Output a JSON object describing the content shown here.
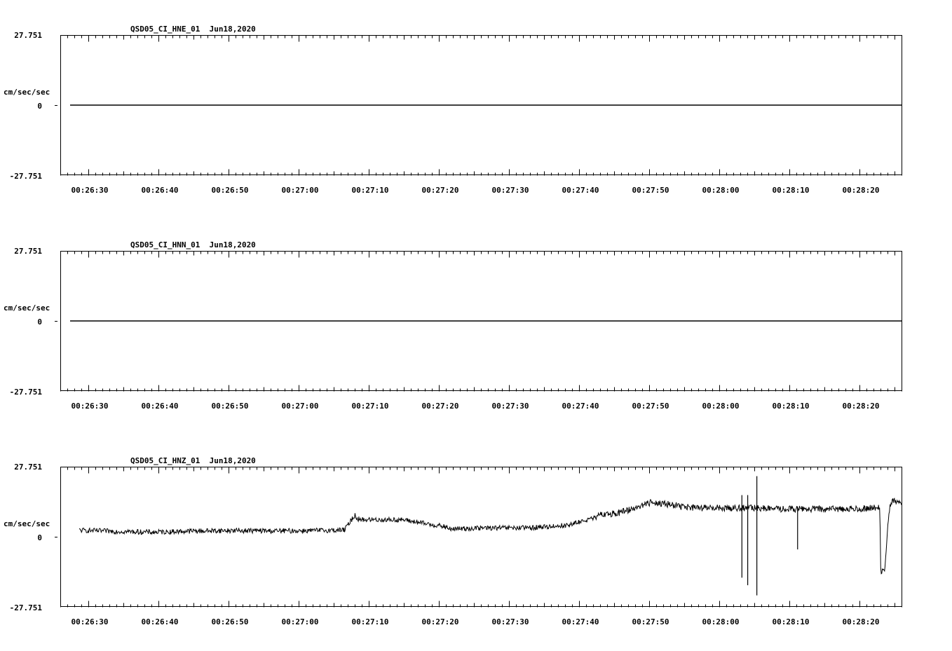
{
  "chart_data": [
    {
      "type": "line",
      "title": "QSD05_CI_HNE_01  Jun18,2020",
      "ylabel": "cm/sec/sec",
      "ylim": [
        -27.751,
        27.751
      ],
      "y_ticks": [
        "27.751",
        "0",
        "-27.751"
      ],
      "x_tick_labels": [
        "00:26:30",
        "00:26:40",
        "00:26:50",
        "00:27:00",
        "00:27:10",
        "00:27:20",
        "00:27:30",
        "00:27:40",
        "00:27:50",
        "00:28:00",
        "00:28:10",
        "00:28:20"
      ],
      "series": [
        {
          "x": [
            0,
            1
          ],
          "values": [
            0,
            0
          ]
        }
      ]
    },
    {
      "type": "line",
      "title": "QSD05_CI_HNN_01  Jun18,2020",
      "ylabel": "cm/sec/sec",
      "ylim": [
        -27.751,
        27.751
      ],
      "y_ticks": [
        "27.751",
        "0",
        "-27.751"
      ],
      "x_tick_labels": [
        "00:26:30",
        "00:26:40",
        "00:26:50",
        "00:27:00",
        "00:27:10",
        "00:27:20",
        "00:27:30",
        "00:27:40",
        "00:27:50",
        "00:28:00",
        "00:28:10",
        "00:28:20"
      ],
      "series": [
        {
          "x": [
            0,
            1
          ],
          "values": [
            0,
            0
          ]
        }
      ]
    },
    {
      "type": "line",
      "title": "QSD05_CI_HNZ_01  Jun18,2020",
      "ylabel": "cm/sec/sec",
      "ylim": [
        -27.751,
        27.751
      ],
      "y_ticks": [
        "27.751",
        "0",
        "-27.751"
      ],
      "x_tick_labels": [
        "00:26:30",
        "00:26:40",
        "00:26:50",
        "00:27:00",
        "00:27:10",
        "00:27:20",
        "00:27:30",
        "00:27:40",
        "00:27:50",
        "00:28:00",
        "00:28:10",
        "00:28:20"
      ],
      "series": [
        {
          "x": [
            0.011,
            0.05,
            0.1,
            0.15,
            0.2,
            0.25,
            0.3,
            0.33,
            0.343,
            0.345,
            0.35,
            0.4,
            0.45,
            0.455,
            0.46,
            0.5,
            0.55,
            0.6,
            0.62,
            0.63,
            0.635,
            0.64,
            0.66,
            0.7,
            0.75,
            0.8,
            0.83,
            0.85,
            0.86,
            0.87,
            0.9,
            0.95,
            0.974,
            0.975,
            0.98,
            0.985,
            0.99,
            1.0
          ],
          "values": [
            2.6,
            2.2,
            1.8,
            2.3,
            2.5,
            2.3,
            2.5,
            2.7,
            8.9,
            7.2,
            6.8,
            6.7,
            4.0,
            3.2,
            3.1,
            3.5,
            3.5,
            4.6,
            6.6,
            7.2,
            8.1,
            8.9,
            9.4,
            13.8,
            11.4,
            11.4,
            11.4,
            11.0,
            11.0,
            11.0,
            11.0,
            11.1,
            11.7,
            -14.4,
            -12.5,
            10.9,
            14.3,
            13.3
          ]
        }
      ],
      "spikes": [
        {
          "x": 0.808,
          "values": [
            16.5,
            -16.2
          ]
        },
        {
          "x": 0.815,
          "values": [
            16.5,
            -19.2
          ]
        },
        {
          "x": 0.826,
          "values": [
            24.0,
            -23.2
          ]
        },
        {
          "x": 0.875,
          "values": [
            12.0,
            -5.0
          ]
        },
        {
          "x": 0.955,
          "values": [
            12.5,
            10.0
          ]
        }
      ]
    }
  ]
}
